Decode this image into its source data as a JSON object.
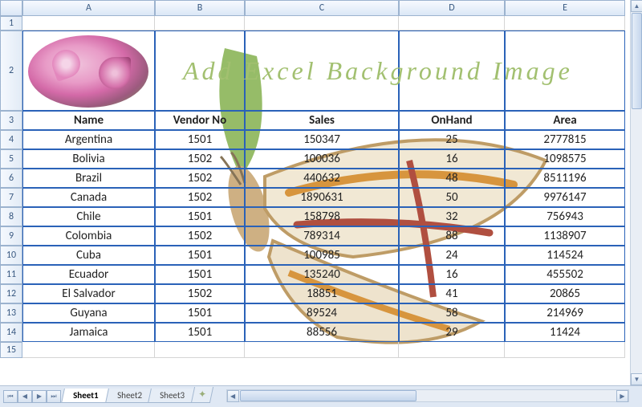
{
  "columns": [
    "A",
    "B",
    "C",
    "D",
    "E"
  ],
  "row_numbers": [
    1,
    2,
    3,
    4,
    5,
    6,
    7,
    8,
    9,
    10,
    11,
    12,
    13,
    14,
    15
  ],
  "title": "Add  Excel  Background  Image",
  "headers": {
    "name": "Name",
    "vendor": "Vendor No",
    "sales": "Sales",
    "onhand": "OnHand",
    "area": "Area"
  },
  "rows": [
    {
      "name": "Argentina",
      "vendor": "1501",
      "sales": "150347",
      "onhand": "25",
      "area": "2777815"
    },
    {
      "name": "Bolivia",
      "vendor": "1502",
      "sales": "100036",
      "onhand": "16",
      "area": "1098575"
    },
    {
      "name": "Brazil",
      "vendor": "1502",
      "sales": "440632",
      "onhand": "48",
      "area": "8511196"
    },
    {
      "name": "Canada",
      "vendor": "1502",
      "sales": "1890631",
      "onhand": "50",
      "area": "9976147"
    },
    {
      "name": "Chile",
      "vendor": "1501",
      "sales": "158798",
      "onhand": "32",
      "area": "756943"
    },
    {
      "name": "Colombia",
      "vendor": "1502",
      "sales": "789314",
      "onhand": "88",
      "area": "1138907"
    },
    {
      "name": "Cuba",
      "vendor": "1501",
      "sales": "100985",
      "onhand": "24",
      "area": "114524"
    },
    {
      "name": "Ecuador",
      "vendor": "1501",
      "sales": "135240",
      "onhand": "16",
      "area": "455502"
    },
    {
      "name": "El Salvador",
      "vendor": "1502",
      "sales": "18851",
      "onhand": "41",
      "area": "20865"
    },
    {
      "name": "Guyana",
      "vendor": "1501",
      "sales": "89524",
      "onhand": "58",
      "area": "214969"
    },
    {
      "name": "Jamaica",
      "vendor": "1501",
      "sales": "88556",
      "onhand": "29",
      "area": "11424"
    }
  ],
  "tabs": [
    {
      "label": "Sheet1",
      "active": true
    },
    {
      "label": "Sheet2",
      "active": false
    },
    {
      "label": "Sheet3",
      "active": false
    }
  ],
  "new_tab_glyph": "✦"
}
